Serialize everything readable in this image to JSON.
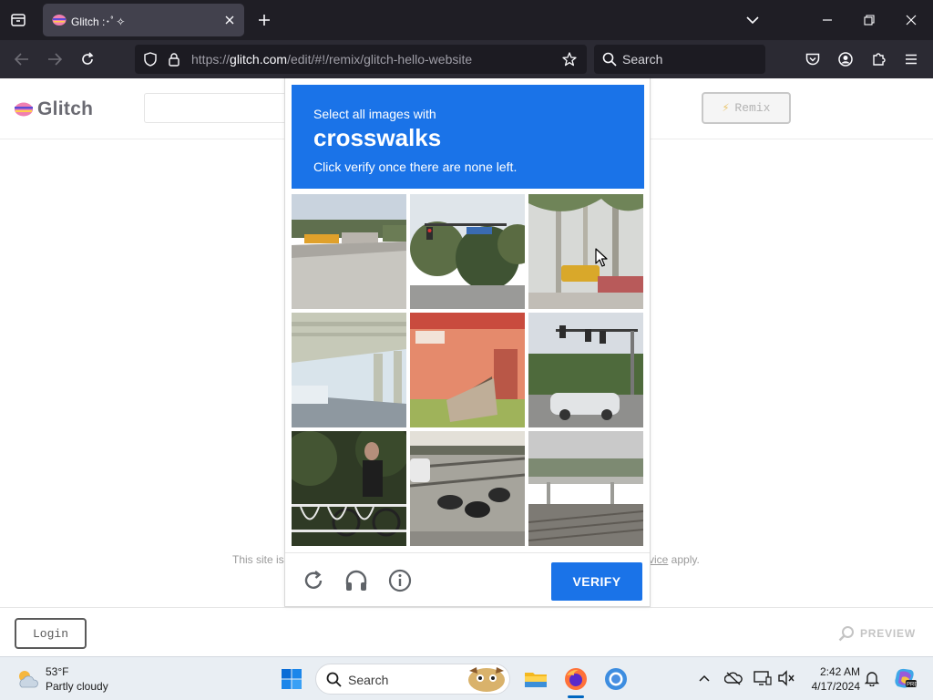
{
  "browser": {
    "tab": {
      "title": "Glitch :･ﾟ✧"
    },
    "url": {
      "prefix": "https://",
      "domain": "glitch.com",
      "path": "/edit/#!/remix/glitch-hello-website"
    },
    "search": {
      "placeholder": "Search"
    }
  },
  "page": {
    "logo_text": "Glitch",
    "remix_label": "Remix",
    "notice_left": "This site is",
    "notice_right_link": "vice",
    "notice_right_tail": " apply.",
    "login_label": "Login",
    "preview_label": "PREVIEW"
  },
  "captcha": {
    "select_label": "Select all images with",
    "keyword": "crosswalks",
    "instruction": "Click verify once there are none left.",
    "verify_label": "VERIFY",
    "tiles": [
      {
        "name": "tile-school-bus-road",
        "selected": false
      },
      {
        "name": "tile-traffic-light-trees",
        "selected": false
      },
      {
        "name": "tile-taxi-palm-trees",
        "selected": false
      },
      {
        "name": "tile-overpass",
        "selected": false
      },
      {
        "name": "tile-storefront-ramp",
        "selected": false
      },
      {
        "name": "tile-traffic-lights-car",
        "selected": false
      },
      {
        "name": "tile-cyclist-railing",
        "selected": false
      },
      {
        "name": "tile-motorcycles-tracks",
        "selected": false
      },
      {
        "name": "tile-highway-bridge",
        "selected": false
      }
    ]
  },
  "taskbar": {
    "weather_temp": "53°F",
    "weather_desc": "Partly cloudy",
    "search_label": "Search",
    "time": "2:42 AM",
    "date": "4/17/2024"
  },
  "colors": {
    "captcha_blue": "#1a73e8",
    "browser_dark": "#1f1e25",
    "toolbar": "#2b2a33"
  }
}
